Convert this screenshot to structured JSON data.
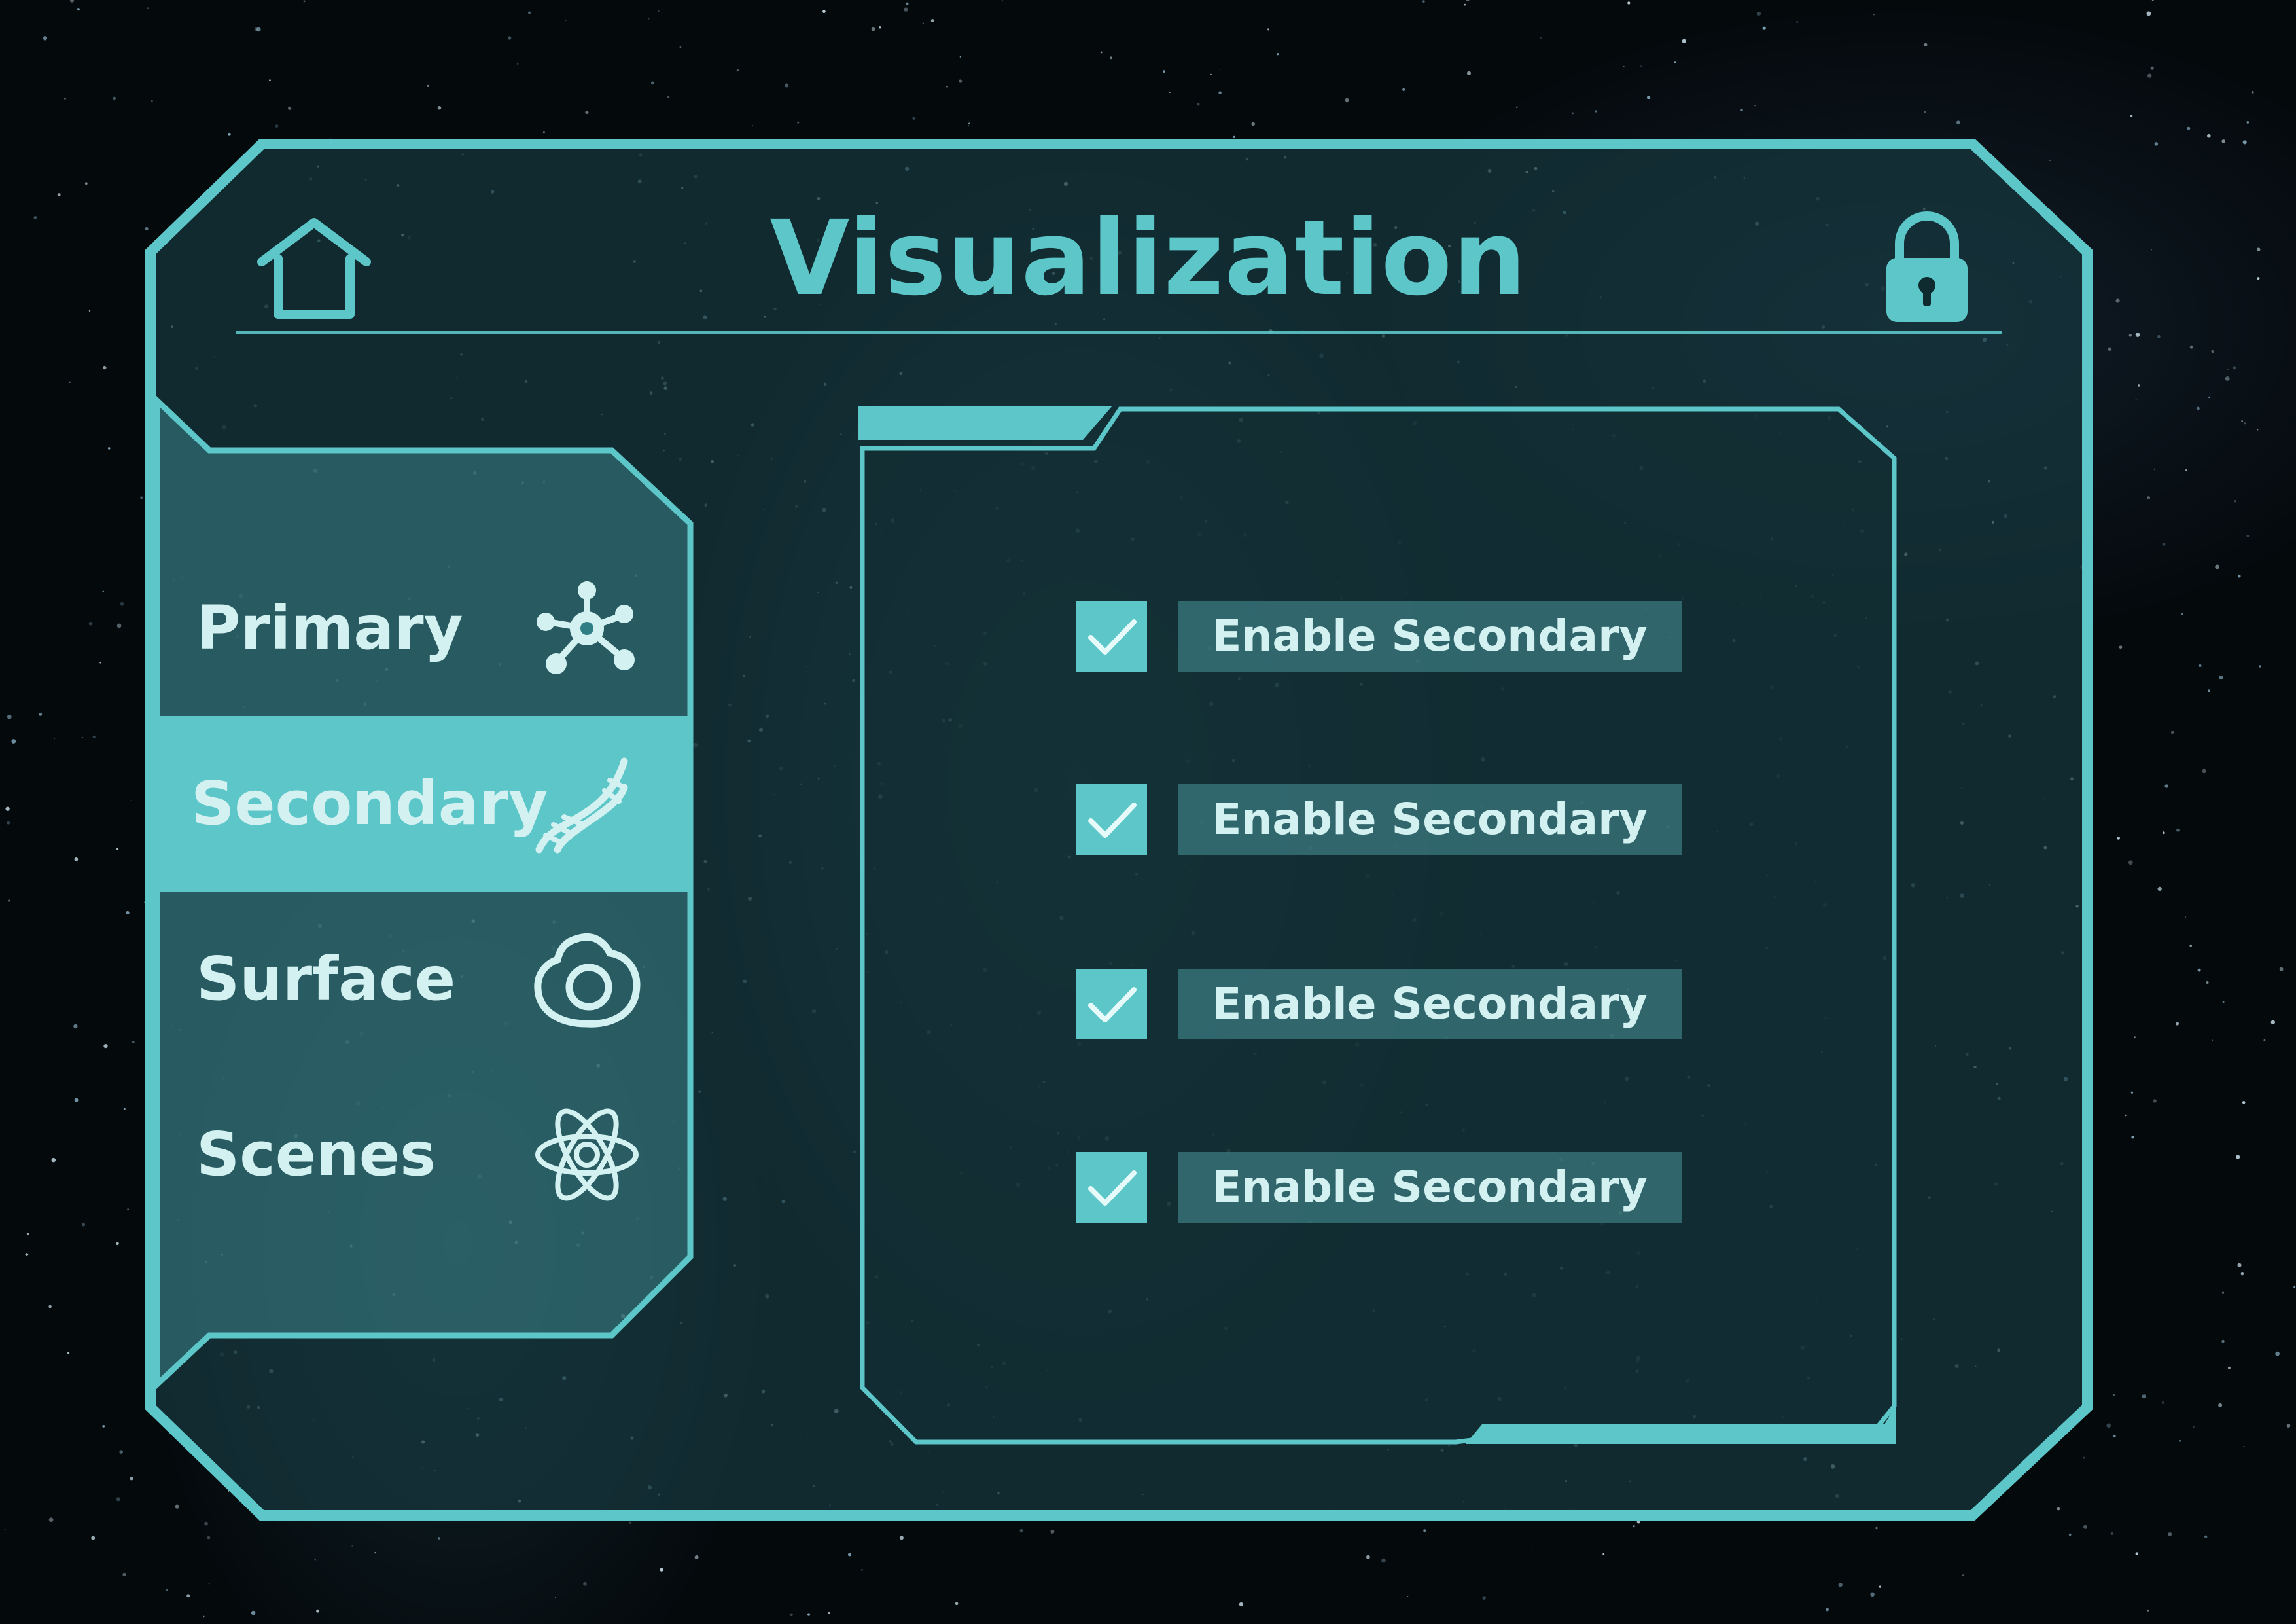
{
  "header": {
    "title": "Visualization",
    "home_icon": "home-icon",
    "lock_icon": "lock-icon"
  },
  "sidebar": {
    "items": [
      {
        "label": "Primary",
        "icon": "molecule-icon",
        "active": false
      },
      {
        "label": "Secondary",
        "icon": "dna-icon",
        "active": true
      },
      {
        "label": "Surface",
        "icon": "cell-icon",
        "active": false
      },
      {
        "label": "Scenes",
        "icon": "atom-icon",
        "active": false
      }
    ]
  },
  "options": [
    {
      "label": "Enable Secondary",
      "checked": true
    },
    {
      "label": "Enable Secondary",
      "checked": true
    },
    {
      "label": "Enable Secondary",
      "checked": true
    },
    {
      "label": "Enable Secondary",
      "checked": true
    }
  ],
  "colors": {
    "accent": "#5cc6c8",
    "panel_fill": "#143236",
    "text_light": "#d4f1f1",
    "background": "#04090c"
  }
}
